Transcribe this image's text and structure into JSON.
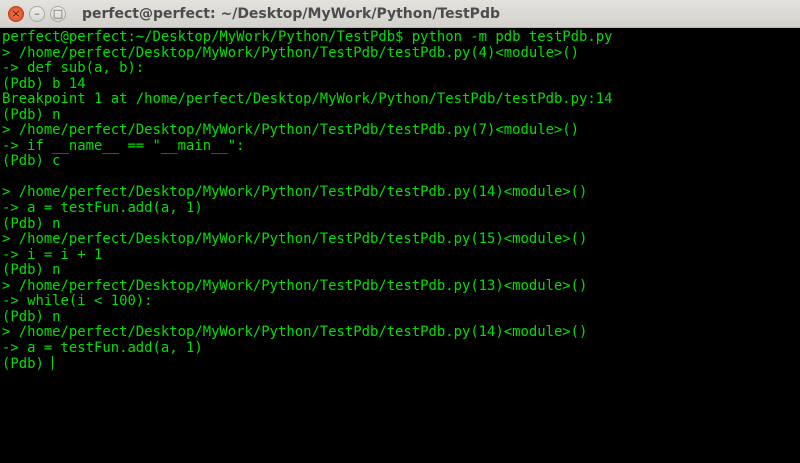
{
  "window": {
    "title": "perfect@perfect: ~/Desktop/MyWork/Python/TestPdb",
    "close_icon": "×",
    "minimize_icon": "–",
    "maximize_icon": "□"
  },
  "terminal": {
    "lines": [
      "perfect@perfect:~/Desktop/MyWork/Python/TestPdb$ python -m pdb testPdb.py",
      "> /home/perfect/Desktop/MyWork/Python/TestPdb/testPdb.py(4)<module>()",
      "-> def sub(a, b):",
      "(Pdb) b 14",
      "Breakpoint 1 at /home/perfect/Desktop/MyWork/Python/TestPdb/testPdb.py:14",
      "(Pdb) n",
      "> /home/perfect/Desktop/MyWork/Python/TestPdb/testPdb.py(7)<module>()",
      "-> if __name__ == \"__main__\":",
      "(Pdb) c",
      "",
      "> /home/perfect/Desktop/MyWork/Python/TestPdb/testPdb.py(14)<module>()",
      "-> a = testFun.add(a, 1)",
      "(Pdb) n",
      "> /home/perfect/Desktop/MyWork/Python/TestPdb/testPdb.py(15)<module>()",
      "-> i = i + 1",
      "(Pdb) n",
      "> /home/perfect/Desktop/MyWork/Python/TestPdb/testPdb.py(13)<module>()",
      "-> while(i < 100):",
      "(Pdb) n",
      "> /home/perfect/Desktop/MyWork/Python/TestPdb/testPdb.py(14)<module>()",
      "-> a = testFun.add(a, 1)"
    ],
    "prompt": "(Pdb) "
  },
  "colors": {
    "text": "#00e000",
    "background": "#000000"
  }
}
